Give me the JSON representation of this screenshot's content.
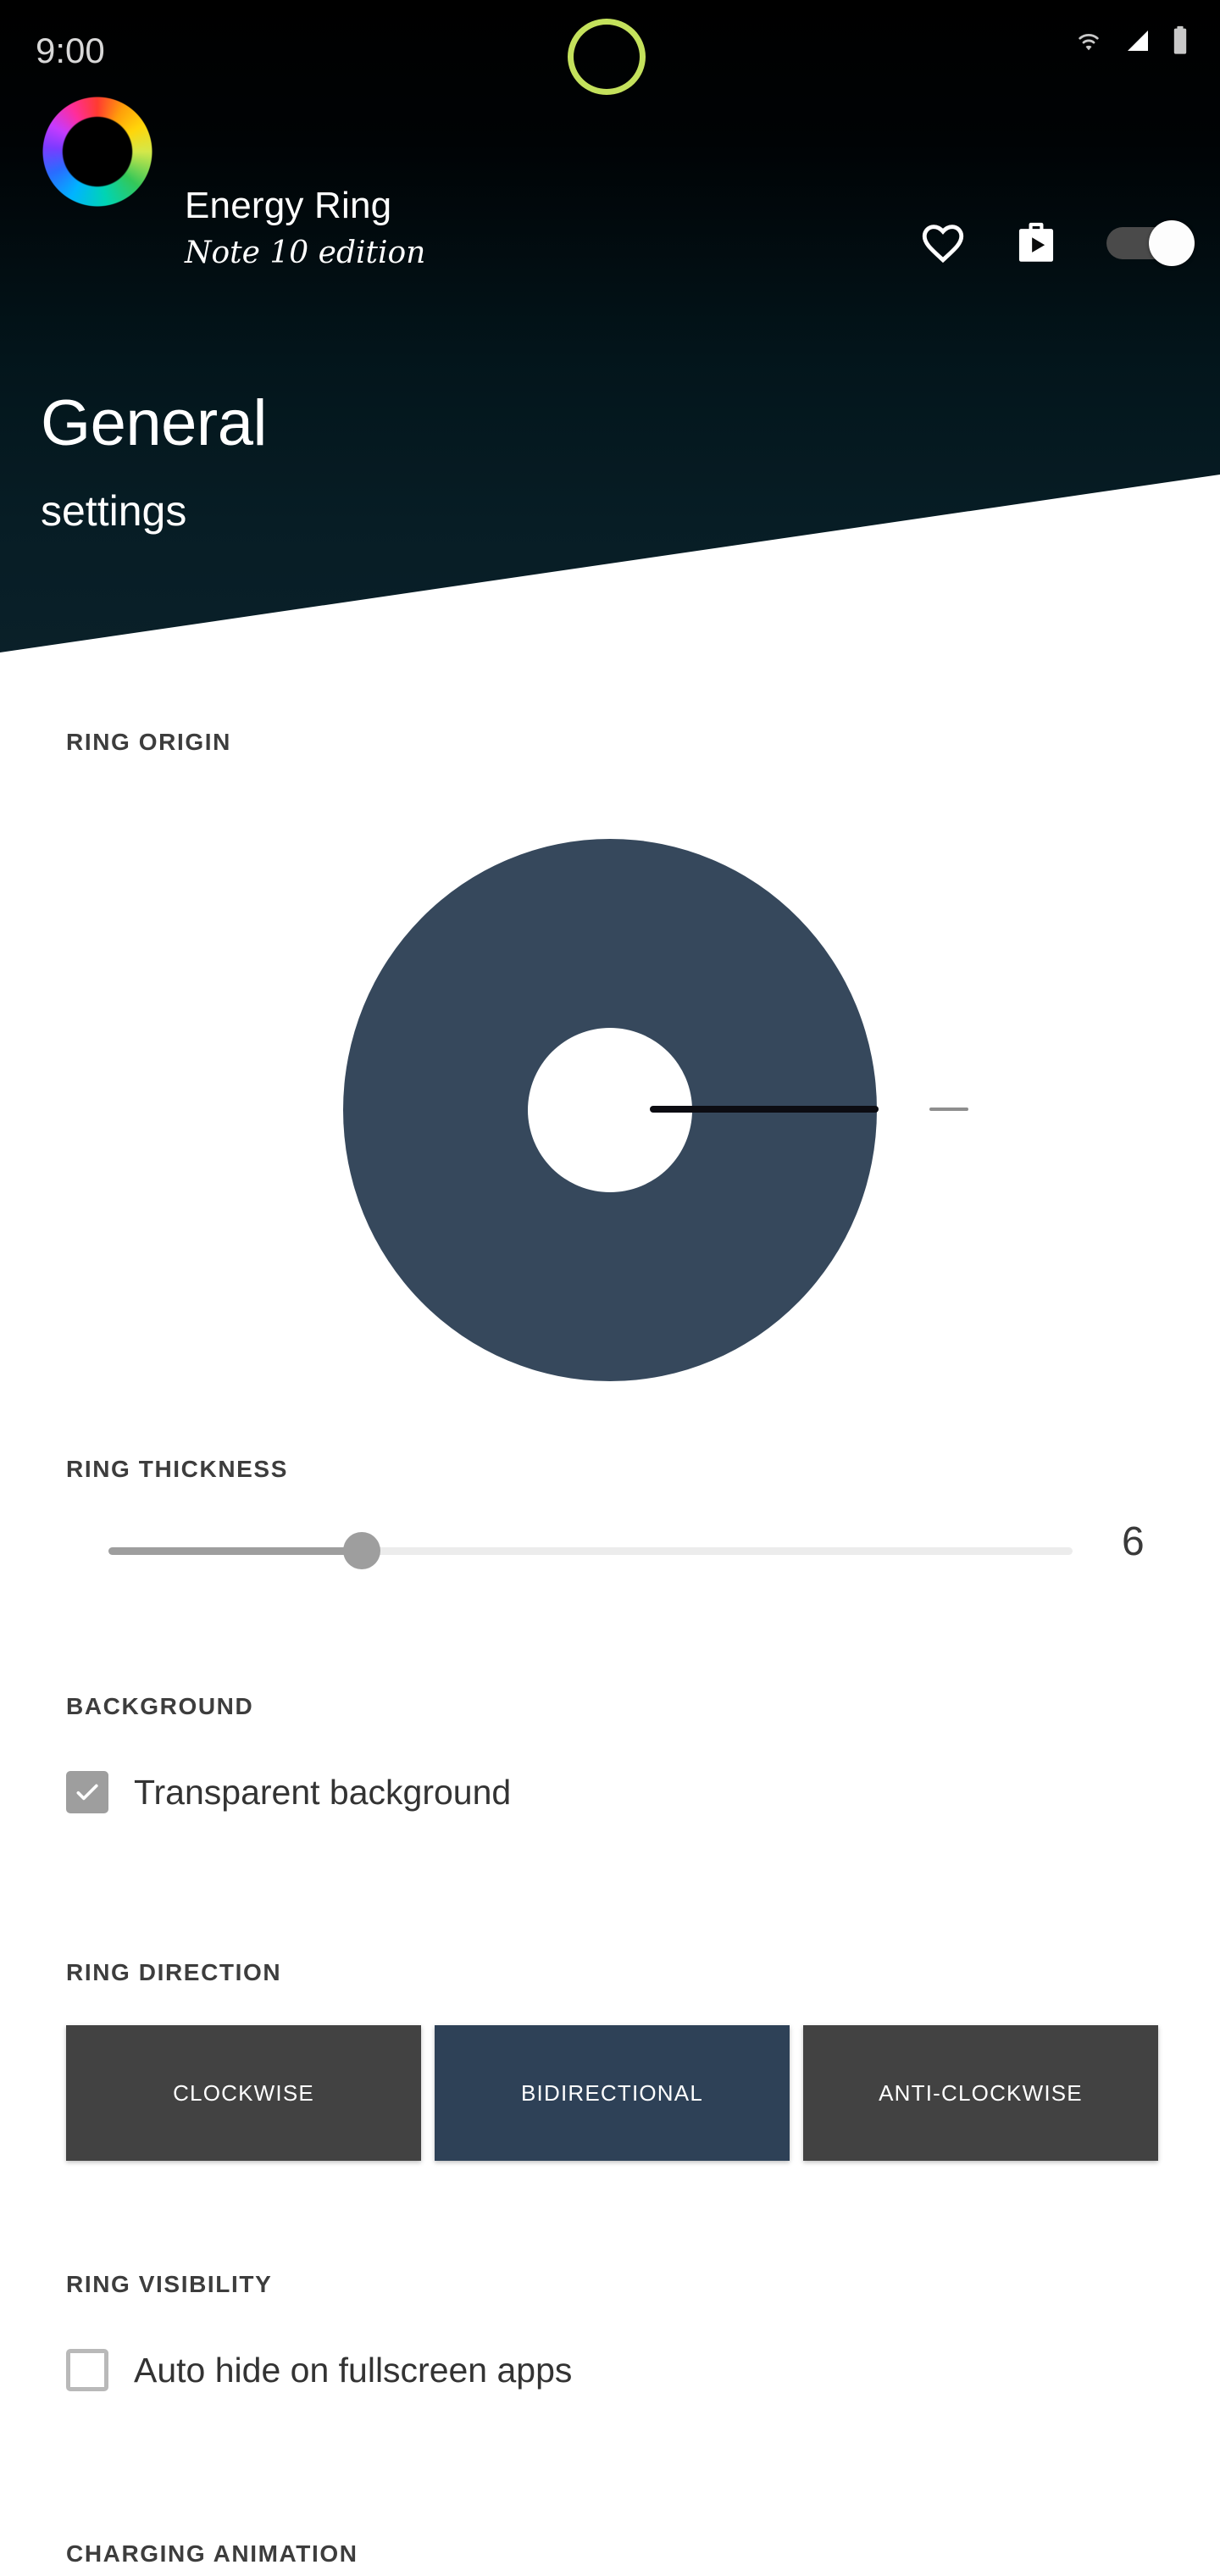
{
  "status_bar": {
    "clock": "9:00",
    "icons": [
      "wifi-icon",
      "signal-icon",
      "battery-icon"
    ],
    "notch_ring_color": "#c4e15c"
  },
  "app_bar": {
    "title": "Energy Ring",
    "subtitle": "Note 10 edition",
    "logo": "rainbow-ring-logo",
    "actions": [
      {
        "name": "favorite-icon",
        "label": "Favorite"
      },
      {
        "name": "play-store-icon",
        "label": "Play Store"
      }
    ],
    "master_toggle": {
      "label": "Master switch",
      "state": "on"
    }
  },
  "page": {
    "title": "General",
    "subtitle": "settings"
  },
  "sections": {
    "ring_origin": {
      "label": "RING ORIGIN",
      "donut_color": "#36485c",
      "handle_angle_degrees": 0,
      "handle_position": "3 o'clock"
    },
    "ring_thickness": {
      "label": "RING THICKNESS",
      "value": "6",
      "slider_percent": 26
    },
    "background": {
      "label": "BACKGROUND",
      "checkbox": {
        "label": "Transparent background",
        "checked": true
      }
    },
    "ring_direction": {
      "label": "RING DIRECTION",
      "options": [
        {
          "label": "CLOCKWISE",
          "selected": false
        },
        {
          "label": "BIDIRECTIONAL",
          "selected": true
        },
        {
          "label": "ANTI-CLOCKWISE",
          "selected": false
        }
      ]
    },
    "ring_visibility": {
      "label": "RING VISIBILITY",
      "checkbox": {
        "label": "Auto hide on fullscreen apps",
        "checked": false
      }
    },
    "charging_animation": {
      "label": "CHARGING ANIMATION"
    }
  },
  "colors": {
    "header_top": "#000000",
    "header_bottom": "#0a2029",
    "accent_navy": "#2e4157",
    "inactive_gray": "#424242",
    "checkbox_gray": "#9e9e9e"
  }
}
